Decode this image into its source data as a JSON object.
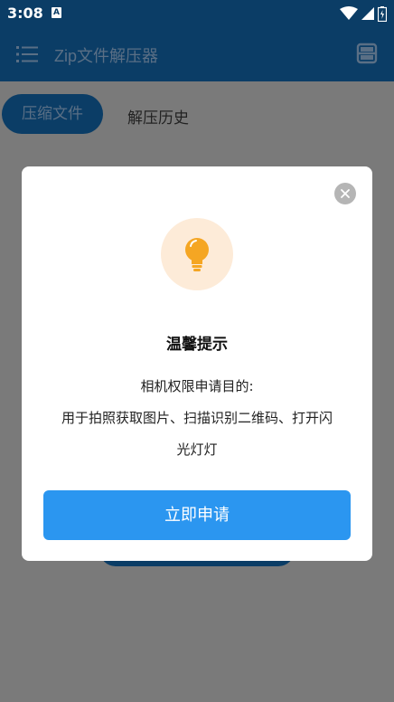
{
  "status_bar": {
    "time": "3:08",
    "notification_icon": "A"
  },
  "app_bar": {
    "title": "Zip文件解压器",
    "menu_icon": "list-menu-icon",
    "scan_icon": "scan-icon"
  },
  "tabs": [
    {
      "label": "压缩文件",
      "active": true
    },
    {
      "label": "解压历史",
      "active": false
    }
  ],
  "dialog": {
    "title": "温馨提示",
    "message_lines": [
      "相机权限申请目的:",
      "用于拍照获取图片、扫描识别二维码、打开闪",
      "光灯灯"
    ],
    "apply_button_label": "立即申请",
    "icon": "lightbulb-icon",
    "close_icon": "close-icon"
  },
  "colors": {
    "primary_dark": "#0b3d66",
    "button_blue": "#2b96f0",
    "bulb_orange": "#f5a623",
    "bulb_bg": "#fdebd8",
    "overlay": "#7a7a7a"
  }
}
